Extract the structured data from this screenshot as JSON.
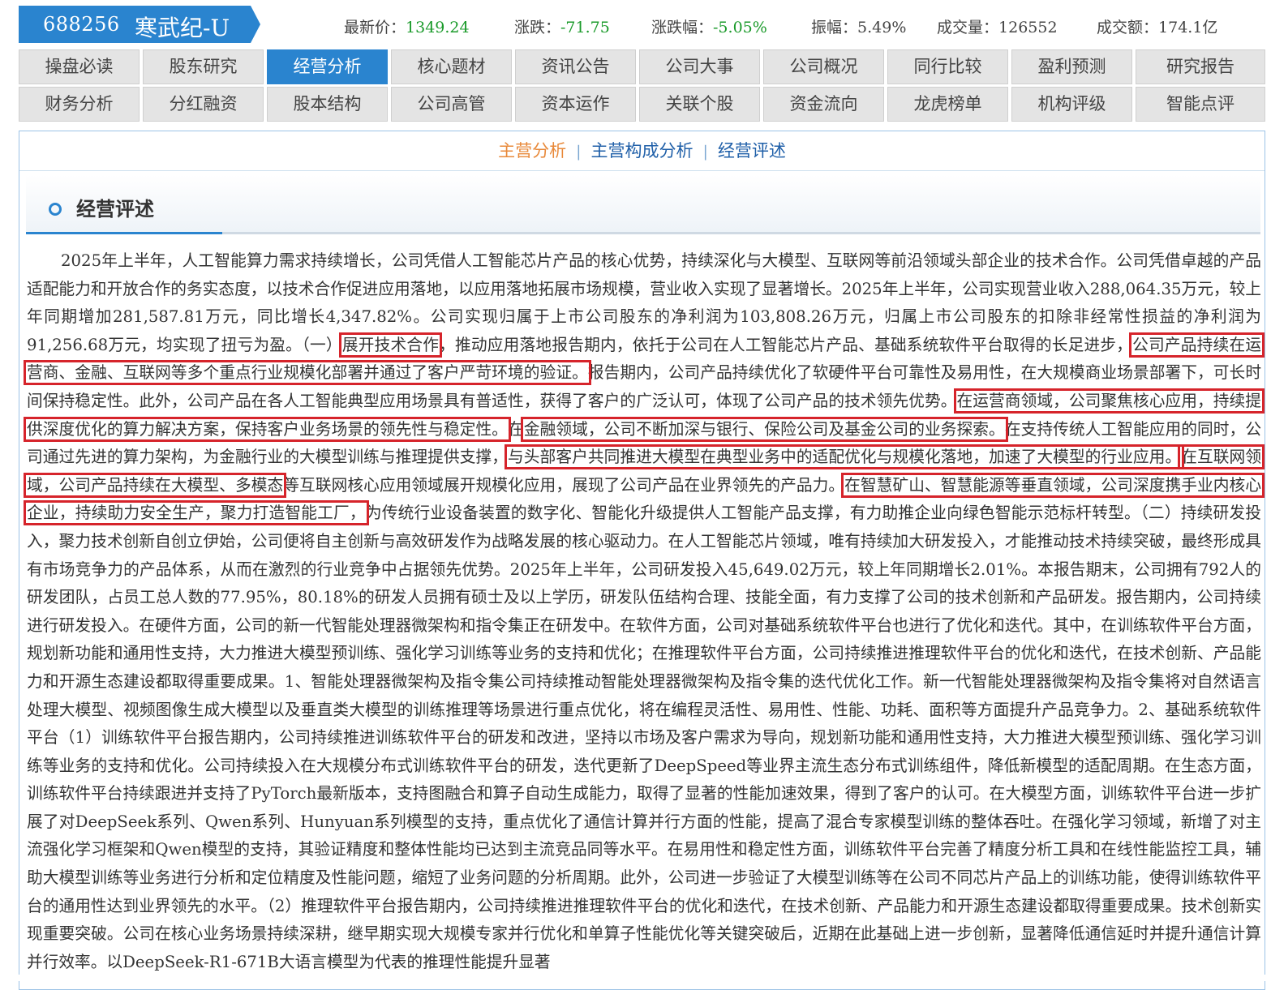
{
  "quote": {
    "code": "688256",
    "name": "寒武纪-U",
    "latest_label": "最新价：",
    "latest_value": "1349.24",
    "change_label": "涨跌：",
    "change_value": "-71.75",
    "pct_label": "涨跌幅：",
    "pct_value": "-5.05%",
    "amp_label": "振幅：",
    "amp_value": "5.49%",
    "vol_label": "成交量：",
    "vol_value": "126552",
    "amt_label": "成交额：",
    "amt_value": "174.1亿",
    "colors": {
      "tag": "#2a84cf",
      "down": "#1a9a2a"
    }
  },
  "tabs_row1": [
    "操盘必读",
    "股东研究",
    "经营分析",
    "核心题材",
    "资讯公告",
    "公司大事",
    "公司概况",
    "同行比较",
    "盈利预测",
    "研究报告"
  ],
  "tabs_row2": [
    "财务分析",
    "分红融资",
    "股本结构",
    "公司高管",
    "资本运作",
    "关联个股",
    "资金流向",
    "龙虎榜单",
    "机构评级",
    "智能点评"
  ],
  "active_tab": "经营分析",
  "subnav": {
    "item1": "主营分析",
    "item2": "主营构成分析",
    "item3": "经营评述",
    "sep": "|"
  },
  "section": {
    "title": "经营评述",
    "icon": "circle-icon"
  },
  "body": {
    "p1": "2025年上半年，人工智能算力需求持续增长，公司凭借人工智能芯片产品的核心优势，持续深化与大模型、互联网等前沿领域头部企业的技术合作。公司凭借卓越的产品适配能力和开放合作的务实态度，以技术合作促进应用落地，以应用落地拓展市场规模，营业收入实现了显著增长。2025年上半年，公司实现营业收入288,064.35万元，较上年同期增加281,587.81万元，同比增长4,347.82%。公司实现归属于上市公司股东的净利润为103,808.26万元，归属上市公司股东的扣除非经常性损益的净利润为91,256.68万元，均实现了扭亏为盈。（一）",
    "h1": "展开技术合作",
    "p2": "，推动应用落地报告期内，依托于公司在人工智能芯片产品、基础系统软件平台取得的长足进步，",
    "h2": "公司产品持续在运营商、金融、互联网等多个重点行业规模化部署并通过了客户严苛环境的验证。",
    "p3": "报告期内，公司产品持续优化了软硬件平台可靠性及易用性，在大规模商业场景部署下，可长时间保持稳定性。此外，公司产品在各人工智能典型应用场景具有普适性，获得了客户的广泛认可，体现了公司产品的技术领先优势。",
    "h3": "在运营商领域，公司聚焦核心应用，持续提供深度优化的算力解决方案，保持客户业务场景的领先性与稳定性。",
    "p4": "在",
    "h4": "金融领域，公司不断加深与银行、保险公司及基金公司的业务探索。",
    "p5": "在支持传统人工智能应用的同时，公司通过先进的算力架构，为金融行业的大模型训练与推理提供支撑，",
    "h5": "与头部客户共同推进大模型在典型业务中的适配优化与规模化落地，加速了大模型的行业应用。",
    "h6": "在互联网领域，公司产品持续在大模型、多模态",
    "p6": "等互联网核心应用领域展开规模化应用，展现了公司产品在业界领先的产品力。",
    "h7": "在智慧矿山、智慧能源等垂直领域，公司深度携手业内核心企业，持续助力安全生产，聚力打造智能工厂，",
    "p7": "为传统行业设备装置的数字化、智能化升级提供人工智能产品支撑，有力助推企业向绿色智能示范标杆转型。（二）持续研发投入，聚力技术创新自创立伊始，公司便将自主创新与高效研发作为战略发展的核心驱动力。在人工智能芯片领域，唯有持续加大研发投入，才能推动技术持续突破，最终形成具有市场竞争力的产品体系，从而在激烈的行业竞争中占据领先优势。2025年上半年，公司研发投入45,649.02万元，较上年同期增长2.01%。本报告期末，公司拥有792人的研发团队，占员工总人数的77.95%，80.18%的研发人员拥有硕士及以上学历，研发队伍结构合理、技能全面，有力支撑了公司的技术创新和产品研发。报告期内，公司持续进行研发投入。在硬件方面，公司的新一代智能处理器微架构和指令集正在研发中。在软件方面，公司对基础系统软件平台也进行了优化和迭代。其中，在训练软件平台方面，规划新功能和通用性支持，大力推进大模型预训练、强化学习训练等业务的支持和优化；在推理软件平台方面，公司持续推进推理软件平台的优化和迭代，在技术创新、产品能力和开源生态建设都取得重要成果。1、智能处理器微架构及指令集公司持续推动智能处理器微架构及指令集的迭代优化工作。新一代智能处理器微架构及指令集将对自然语言处理大模型、视频图像生成大模型以及垂直类大模型的训练推理等场景进行重点优化，将在编程灵活性、易用性、性能、功耗、面积等方面提升产品竞争力。2、基础系统软件平台（1）训练软件平台报告期内，公司持续推进训练软件平台的研发和改进，坚持以市场及客户需求为导向，规划新功能和通用性支持，大力推进大模型预训练、强化学习训练等业务的支持和优化。公司持续投入在大规模分布式训练软件平台的研发，迭代更新了DeepSpeed等业界主流生态分布式训练组件，降低新模型的适配周期。在生态方面，训练软件平台持续跟进并支持了PyTorch最新版本，支持图融合和算子自动生成能力，取得了显著的性能加速效果，得到了客户的认可。在大模型方面，训练软件平台进一步扩展了对DeepSeek系列、Qwen系列、Hunyuan系列模型的支持，重点优化了通信计算并行方面的性能，提高了混合专家模型训练的整体吞吐。在强化学习领域，新增了对主流强化学习框架和Qwen模型的支持，其验证精度和整体性能均已达到主流竞品同等水平。在易用性和稳定性方面，训练软件平台完善了精度分析工具和在线性能监控工具，辅助大模型训练等业务进行分析和定位精度及性能问题，缩短了业务问题的分析周期。此外，公司进一步验证了大模型训练等在公司不同芯片产品上的训练功能，使得训练软件平台的通用性达到业界领先的水平。（2）推理软件平台报告期内，公司持续推进推理软件平台的优化和迭代，在技术创新、产品能力和开源生态建设都取得重要成果。技术创新实现重要突破。公司在核心业务场景持续深耕，继早期实现大规模专家并行优化和单算子性能优化等关键突破后，近期在此基础上进一步创新，显著降低通信延时并提升通信计算并行效率。以DeepSeek-R1-671B大语言模型为代表的推理性能提升显著"
  }
}
